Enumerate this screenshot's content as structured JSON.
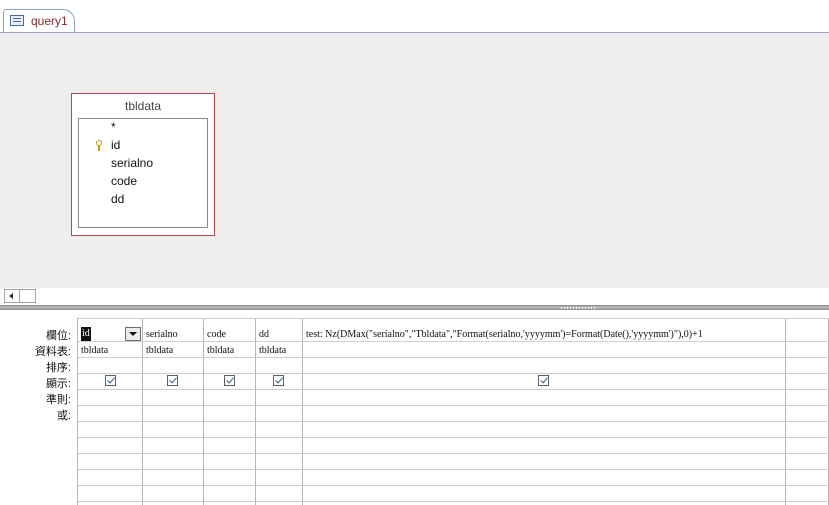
{
  "tab": {
    "label": "query1",
    "icon": "query-icon"
  },
  "table_box": {
    "title": "tbldata",
    "fields": [
      "*",
      "id",
      "serialno",
      "code",
      "dd"
    ],
    "primary_key_field": "id",
    "border_color": "#b24750"
  },
  "grid": {
    "row_labels": [
      "欄位:",
      "資料表:",
      "排序:",
      "顯示:",
      "準則:",
      "或:"
    ],
    "columns": [
      {
        "field": "id",
        "table": "tbldata",
        "show": true
      },
      {
        "field": "serialno",
        "table": "tbldata",
        "show": true
      },
      {
        "field": "code",
        "table": "tbldata",
        "show": true
      },
      {
        "field": "dd",
        "table": "tbldata",
        "show": true
      },
      {
        "field": "test: Nz(DMax(\"serialno\",\"Tbldata\",\"Format(serialno,'yyyymm')=Format(Date(),'yyyymm')\"),0)+1",
        "table": "",
        "show": true
      }
    ]
  }
}
